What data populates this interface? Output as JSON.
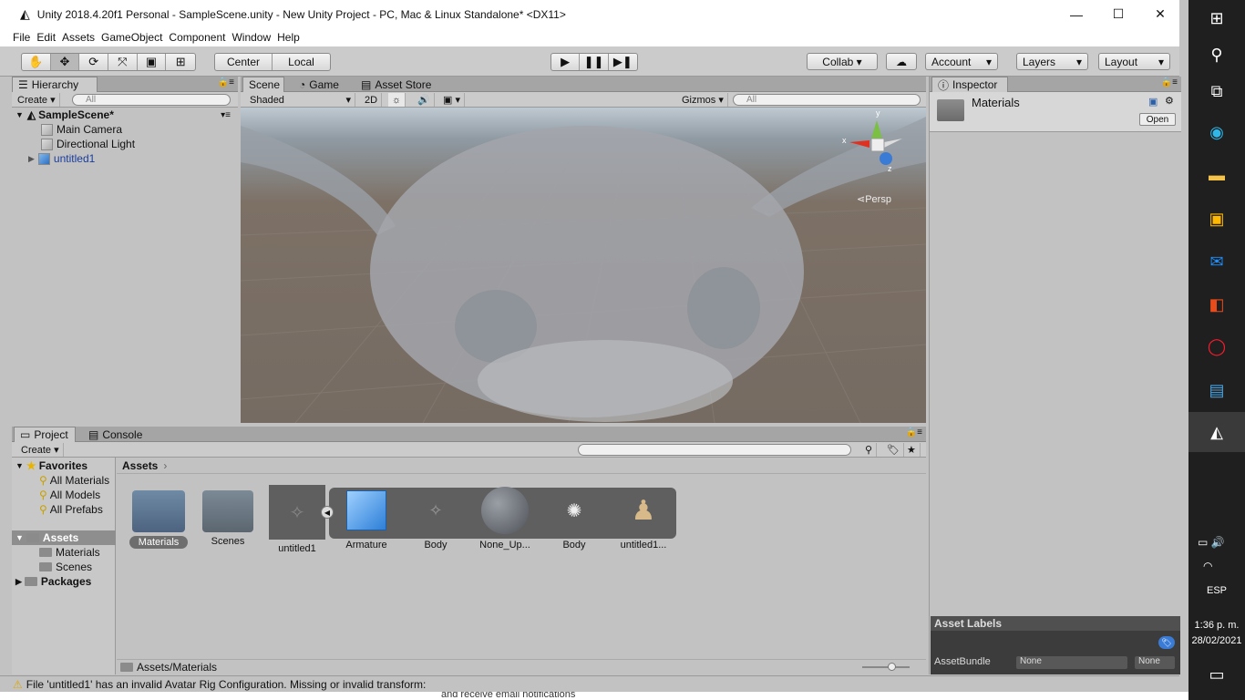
{
  "window": {
    "title": "Unity 2018.4.20f1 Personal - SampleScene.unity - New Unity Project - PC, Mac & Linux Standalone* <DX11>",
    "minimize": "—",
    "maximize": "☐",
    "close": "✕"
  },
  "menu": [
    "File",
    "Edit",
    "Assets",
    "GameObject",
    "Component",
    "Window",
    "Help"
  ],
  "toolbar": {
    "center": "Center",
    "local": "Local",
    "collab": "Collab ▾",
    "account": "Account",
    "layers": "Layers",
    "layout": "Layout"
  },
  "hierarchy": {
    "tab": "Hierarchy",
    "create": "Create ▾",
    "search_placeholder": "All",
    "scene": "SampleScene*",
    "items": [
      "Main Camera",
      "Directional Light",
      "untitled1"
    ]
  },
  "scene": {
    "tabs": [
      "Scene",
      "Game",
      "Asset Store"
    ],
    "shading": "Shaded",
    "mode2d": "2D",
    "gizmos": "Gizmos ▾",
    "search_placeholder": "All",
    "persp": "Persp",
    "axis_y": "y",
    "axis_x": "x",
    "axis_z": "z"
  },
  "project": {
    "tabs": [
      "Project",
      "Console"
    ],
    "create": "Create ▾",
    "favorites": "Favorites",
    "fav_items": [
      "All Materials",
      "All Models",
      "All Prefabs"
    ],
    "assets_root": "Assets",
    "asset_folders": [
      "Materials",
      "Scenes"
    ],
    "packages": "Packages",
    "breadcrumb": "Assets",
    "assets": [
      "Materials",
      "Scenes",
      "untitled1",
      "Armature",
      "Body",
      "None_Up...",
      "Body",
      "untitled1..."
    ],
    "path": "Assets/Materials"
  },
  "inspector": {
    "tab": "Inspector",
    "title": "Materials",
    "open": "Open",
    "asset_labels": "Asset Labels",
    "assetbundle": "AssetBundle",
    "bundle_value": "None",
    "variant_value": "None"
  },
  "status": {
    "message": "File 'untitled1' has an invalid Avatar Rig Configuration. Missing or invalid transform:",
    "behind": "and receive email notifications"
  },
  "taskbar": {
    "lang": "ESP",
    "time": "1:36 p. m.",
    "date": "28/02/2021"
  }
}
